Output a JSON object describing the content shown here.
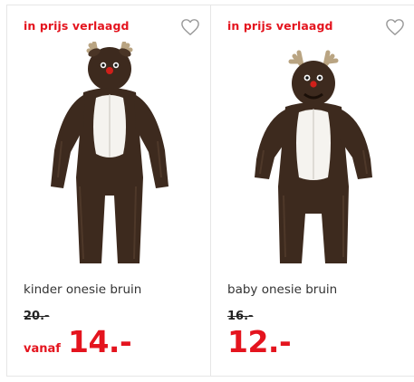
{
  "products": [
    {
      "badge": "in prijs verlaagd",
      "name": "kinder onesie bruin",
      "old_price": "20.-",
      "price_prefix": "vanaf",
      "price": "14.-",
      "heart_icon": "heart-outline-icon"
    },
    {
      "badge": "in prijs verlaagd",
      "name": "baby onesie bruin",
      "old_price": "16.-",
      "price": "12.-",
      "heart_icon": "heart-outline-icon"
    }
  ],
  "colors": {
    "accent_red": "#e4141e",
    "onesie_brown": "#3d2a1e",
    "belly_white": "#f5f3ef",
    "antler_tan": "#b9a482"
  }
}
